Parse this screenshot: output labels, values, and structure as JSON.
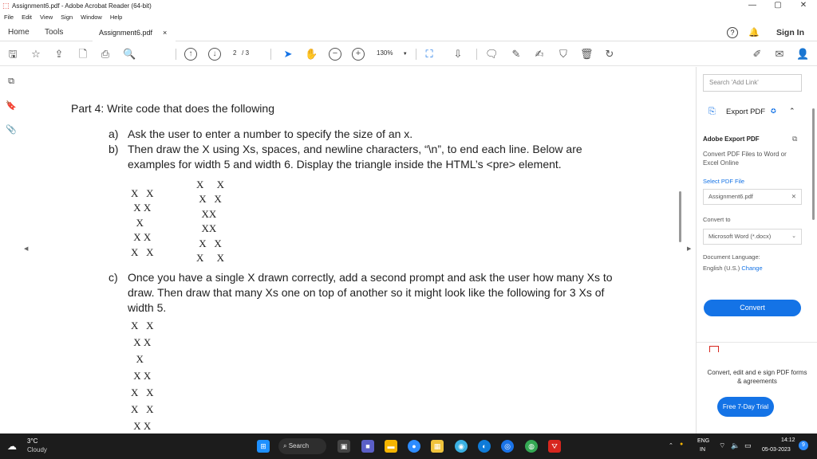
{
  "window": {
    "title": "Assignment6.pdf - Adobe Acrobat Reader (64-bit)",
    "minimize": "—",
    "maximize": "▢",
    "close": "✕"
  },
  "menu": [
    "File",
    "Edit",
    "View",
    "Sign",
    "Window",
    "Help"
  ],
  "tabs": {
    "home": "Home",
    "tools": "Tools",
    "doc": "Assignment6.pdf",
    "doc_close": "×",
    "help": "?",
    "signin": "Sign In"
  },
  "toolbar": {
    "page_current": "2",
    "page_total": "/ 3",
    "zoom": "130%"
  },
  "document": {
    "heading": "Part 4: Write code that does the following",
    "item_a_marker": "a)",
    "item_a": "Ask the user to enter a number to specify the size of an x.",
    "item_b_marker": "b)",
    "item_b_line1": "Then draw the X using Xs, spaces, and newline characters, “\\n”, to end each line.  Below are",
    "item_b_line2": "examples for width 5 and width 6. Display the triangle inside the HTML’s <pre> element.",
    "x5_lines": [
      "X   X",
      " X X",
      "  X",
      " X X",
      "X   X"
    ],
    "x6_lines": [
      "X     X",
      " X   X",
      "  XX",
      "  XX",
      " X   X",
      "X     X"
    ],
    "item_c_marker": "c)",
    "item_c_line1": "Once you have a single X drawn correctly, add a second prompt and ask the user how many Xs to",
    "item_c_line2": "draw.  Then draw that many Xs one on top of another so it might look like the following for 3 Xs of",
    "item_c_line3": "width 5.",
    "x_stack_lines": [
      "X   X",
      " X X",
      "  X",
      " X X",
      "X   X",
      "X   X",
      " X X"
    ]
  },
  "right_panel": {
    "search_placeholder": "Search 'Add Link'",
    "export_title": "Export PDF",
    "section_title": "Adobe Export PDF",
    "description": "Convert PDF Files to Word or Excel Online",
    "select_label": "Select PDF File",
    "selected_file": "Assignment6.pdf",
    "convert_to_label": "Convert to",
    "convert_to_value": "Microsoft Word (*.docx)",
    "language_label": "Document Language:",
    "language_value": "English (U.S.)",
    "language_change": "Change",
    "convert_button": "Convert",
    "promo_text": "Convert, edit and e sign PDF forms & agreements",
    "trial_button": "Free 7-Day Trial"
  },
  "taskbar": {
    "temperature": "3°C",
    "weather": "Cloudy",
    "search": "Search",
    "lang_top": "ENG",
    "lang_bottom": "IN",
    "time": "14:12",
    "date": "05-03-2023",
    "notifications": "9"
  },
  "colors": {
    "accent": "#1473e6",
    "acrobat_red": "#d7261e",
    "taskbar": "#1c1c1c"
  }
}
